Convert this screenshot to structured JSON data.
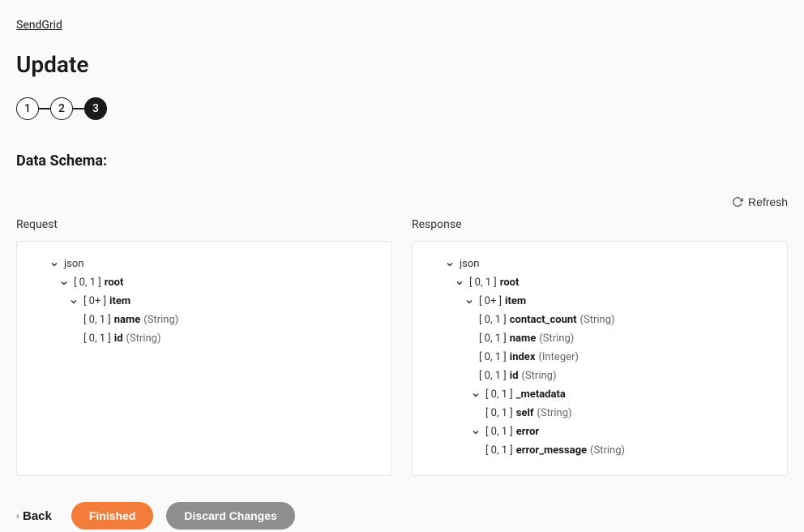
{
  "breadcrumb": "SendGrid",
  "title": "Update",
  "stepper": {
    "steps": [
      "1",
      "2",
      "3"
    ],
    "active_index": 2
  },
  "section_title": "Data Schema:",
  "refresh_label": "Refresh",
  "panels": {
    "request_label": "Request",
    "response_label": "Response"
  },
  "request_tree": {
    "json_label": "json",
    "root": {
      "cardinality": "[ 0, 1 ]",
      "name": "root"
    },
    "item": {
      "cardinality": "[ 0+ ]",
      "name": "item"
    },
    "fields": [
      {
        "cardinality": "[ 0, 1 ]",
        "name": "name",
        "type": "(String)"
      },
      {
        "cardinality": "[ 0, 1 ]",
        "name": "id",
        "type": "(String)"
      }
    ]
  },
  "response_tree": {
    "json_label": "json",
    "root": {
      "cardinality": "[ 0, 1 ]",
      "name": "root"
    },
    "item": {
      "cardinality": "[ 0+ ]",
      "name": "item"
    },
    "item_fields": [
      {
        "cardinality": "[ 0, 1 ]",
        "name": "contact_count",
        "type": "(String)"
      },
      {
        "cardinality": "[ 0, 1 ]",
        "name": "name",
        "type": "(String)"
      },
      {
        "cardinality": "[ 0, 1 ]",
        "name": "index",
        "type": "(Integer)"
      },
      {
        "cardinality": "[ 0, 1 ]",
        "name": "id",
        "type": "(String)"
      }
    ],
    "metadata": {
      "cardinality": "[ 0, 1 ]",
      "name": "_metadata"
    },
    "metadata_fields": [
      {
        "cardinality": "[ 0, 1 ]",
        "name": "self",
        "type": "(String)"
      }
    ],
    "error": {
      "cardinality": "[ 0, 1 ]",
      "name": "error"
    },
    "error_fields": [
      {
        "cardinality": "[ 0, 1 ]",
        "name": "error_message",
        "type": "(String)"
      }
    ]
  },
  "footer": {
    "back": "Back",
    "finished": "Finished",
    "discard": "Discard Changes"
  }
}
